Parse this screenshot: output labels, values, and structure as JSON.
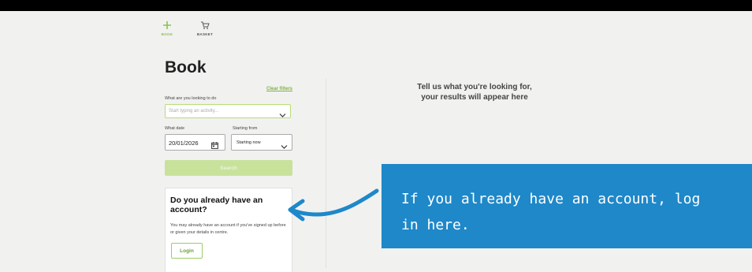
{
  "nav": {
    "book_label": "BOOK",
    "basket_label": "BASKET"
  },
  "page": {
    "title": "Book"
  },
  "form": {
    "clear_filters": "Clear filters",
    "activity_label": "What are you looking to do",
    "activity_placeholder": "Start typing an activity...",
    "date_label": "What date",
    "date_value": "20/01/2026",
    "starting_label": "Starting from",
    "starting_value": "Starting now",
    "search_label": "Search"
  },
  "account_card": {
    "title": "Do you already have an account?",
    "body": "You may already have an account if you've signed up before or given your details in centre.",
    "login_label": "Login"
  },
  "results": {
    "message": "Tell us what you're looking for,\nyour results will appear here"
  },
  "callout": {
    "text": "If you already have an account, log in here."
  },
  "colors": {
    "accent_green": "#8bc34a",
    "callout_blue": "#1e88c9"
  }
}
